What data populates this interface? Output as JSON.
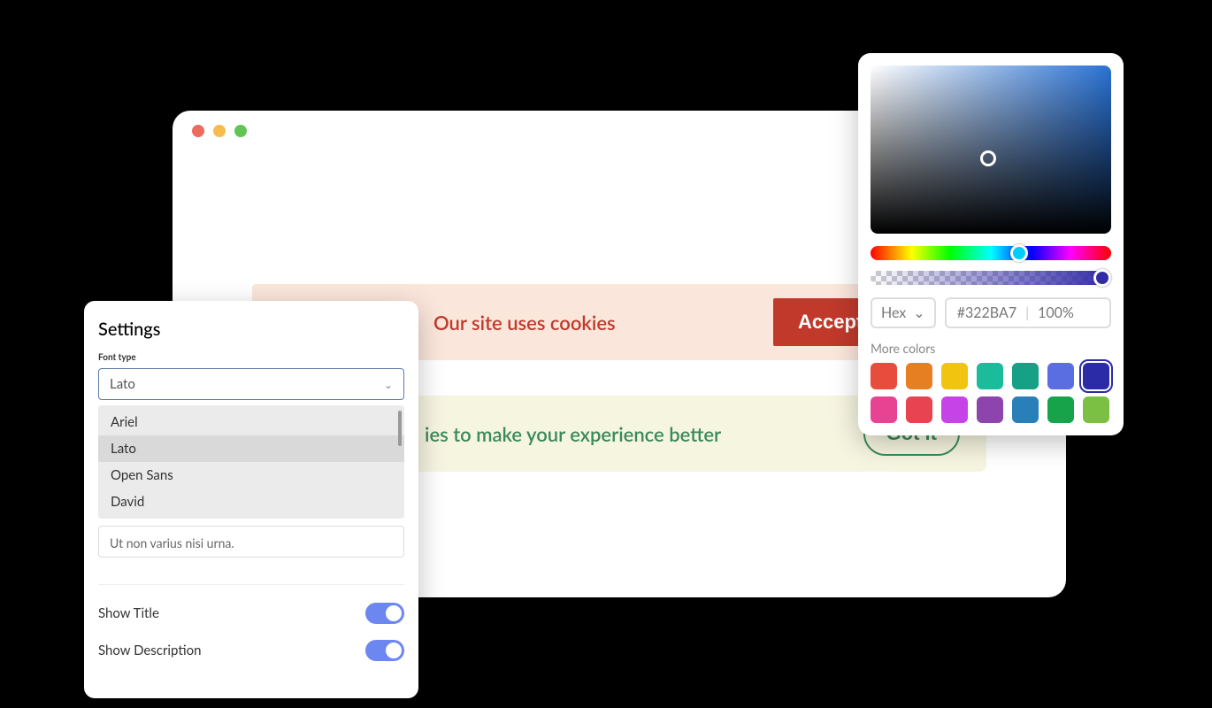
{
  "browser": {
    "banner1": {
      "title": "Our site uses cookies",
      "button": "Accept Cookies"
    },
    "banner2": {
      "text": "ies to make your experience better",
      "button": "Got it"
    }
  },
  "settings": {
    "title": "Settings",
    "font_label": "Font type",
    "selected_font": "Lato",
    "options": [
      "Ariel",
      "Lato",
      "Open Sans",
      "David"
    ],
    "textarea_value": "Ut non varius nisi urna.",
    "show_title_label": "Show Title",
    "show_description_label": "Show Description",
    "show_title_on": true,
    "show_description_on": true
  },
  "picker": {
    "format_label": "Hex",
    "hex_value": "#322BA7",
    "opacity_label": "100%",
    "more_label": "More colors",
    "swatches": [
      "#e74c3c",
      "#e67e22",
      "#f1c40f",
      "#1abc9c",
      "#16a085",
      "#5b6ee1",
      "#2b2ba7",
      "#e84393",
      "#e84350",
      "#c643e8",
      "#8e44ad",
      "#2980b9",
      "#16a34a",
      "#7bc043"
    ],
    "selected_swatch_index": 6
  }
}
